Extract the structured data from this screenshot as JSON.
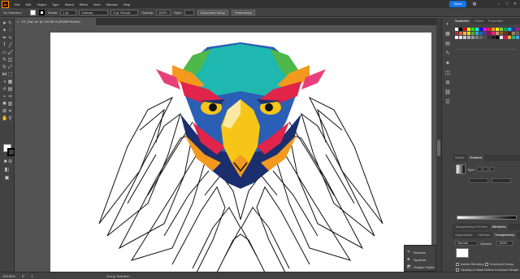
{
  "menubar": {
    "items": [
      "File",
      "Edit",
      "Object",
      "Type",
      "Select",
      "Effect",
      "View",
      "Window",
      "Help"
    ],
    "share_label": "Share"
  },
  "control": {
    "selection_label": "No Selection",
    "stroke_label": "Stroke:",
    "stroke_weight": "1 pt",
    "uniform_label": "Uniform",
    "brush_label": "5 pt. Round",
    "opacity_label": "Opacity:",
    "opacity_value": "100%",
    "style_label": "Style:",
    "doc_setup": "Document Setup",
    "preferences": "Preferences"
  },
  "document": {
    "tab_title": "OT_EaC.ai* @ 106.56 % (RGB/Preview)"
  },
  "panels": {
    "top_tabs": [
      "Swatches",
      "Colors",
      "Properties"
    ],
    "mid_tabs": [
      "Stroke",
      "Gradient"
    ],
    "gradient_type_label": "Type:",
    "transparency_tabs": [
      "Transparency Preview",
      "Attributes"
    ],
    "lower_tabs": [
      "Appearance",
      "Libraries",
      "Transparency"
    ],
    "blend_mode": "Normal",
    "opacity_label": "Opacity:",
    "opacity_value": "100%",
    "isolate_blending": "Isolate Blending",
    "knockout_group": "Knockout Group",
    "opacity_mask": "Opacity & Mask Define Knockout Shape"
  },
  "float_panel": {
    "items": [
      "Brushes",
      "Symbols",
      "Graphic Styles"
    ]
  },
  "status": {
    "zoom": "106.56%",
    "rotation": "0°",
    "page": "1",
    "tool_hint": "Group Selection"
  },
  "swatches": [
    "#ffffff",
    "#000000",
    "#ff0000",
    "#ffff00",
    "#00ff00",
    "#00ffff",
    "#0000ff",
    "#ff00ff",
    "#ed1c24",
    "#f7941d",
    "#fff200",
    "#8dc63f",
    "#00a651",
    "#00aeef",
    "#2e3192",
    "#92278f",
    "#c1272d",
    "#f15a24",
    "#fbb03b",
    "#d9e021",
    "#39b54a",
    "#29abe2",
    "#0071bc",
    "#662d91",
    "#9e005d",
    "#ed1e79",
    "#c69c6d",
    "#8c6239",
    "#603813",
    "#42210b",
    "#998675",
    "#736357",
    "#ffffff",
    "#e6e6e6",
    "#cccccc",
    "#b3b3b3",
    "#999999",
    "#808080",
    "#666666",
    "#4d4d4d",
    "#333333",
    "#1a1a1a",
    "#000000",
    "#f2f2f2",
    "#d4145a",
    "#fbb03b",
    "#22b573",
    "#3fa9f5"
  ],
  "artwork_colors": {
    "teal": "#1fb8b0",
    "green": "#4fb84a",
    "red": "#e0244a",
    "orange": "#f39a1e",
    "blue": "#2a5fb5",
    "dark_blue": "#1b2f6e",
    "yellow": "#f5c518",
    "pink": "#e8407a"
  }
}
